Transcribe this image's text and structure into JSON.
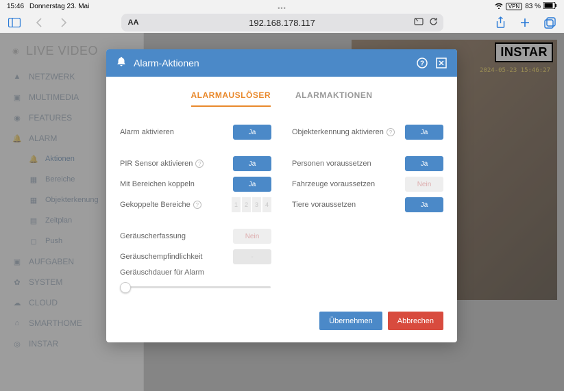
{
  "statusbar": {
    "time": "15:46",
    "date": "Donnerstag 23. Mai",
    "vpn": "VPN",
    "battery": "83 %"
  },
  "browser": {
    "url": "192.168.178.117",
    "aa": "AA"
  },
  "sidebar": {
    "title": "LIVE VIDEO",
    "items": [
      {
        "icon": "◆",
        "label": "NETZWERK"
      },
      {
        "icon": "▣",
        "label": "MULTIMEDIA"
      },
      {
        "icon": "◉",
        "label": "FEATURES"
      },
      {
        "icon": "🔔",
        "label": "ALARM"
      }
    ],
    "sub": [
      {
        "icon": "🔔",
        "label": "Aktionen"
      },
      {
        "icon": "▦",
        "label": "Bereiche"
      },
      {
        "icon": "▦",
        "label": "Objekterkenung"
      },
      {
        "icon": "▤",
        "label": "Zeitplan"
      },
      {
        "icon": "◻",
        "label": "Push"
      }
    ],
    "rest": [
      {
        "icon": "▣",
        "label": "AUFGABEN"
      },
      {
        "icon": "✿",
        "label": "SYSTEM"
      },
      {
        "icon": "☁",
        "label": "CLOUD"
      },
      {
        "icon": "⌂",
        "label": "SMARTHOME"
      },
      {
        "icon": "◎",
        "label": "INSTAR"
      }
    ]
  },
  "logo": {
    "prefix": "IN",
    "suffix": "STAR"
  },
  "camera_ts": "2024-05-23 15:46:27",
  "modal": {
    "title": "Alarm-Aktionen",
    "tabs": {
      "t1": "ALARMAUSLÖSER",
      "t2": "ALARMAKTIONEN"
    },
    "left": {
      "r1": "Alarm aktivieren",
      "r2": "PIR Sensor aktivieren",
      "r3": "Mit Bereichen koppeln",
      "r4": "Gekoppelte Bereiche",
      "r5": "Geräuscherfassung",
      "r6": "Geräuschempfindlichkeit",
      "r7": "Geräuschdauer für Alarm"
    },
    "right": {
      "r1": "Objekterkennung aktivieren",
      "r2": "Personen voraussetzen",
      "r3": "Fahrzeuge voraussetzen",
      "r4": "Tiere voraussetzen"
    },
    "toggles": {
      "yes": "Ja",
      "no": "Nein"
    },
    "nums": [
      "1",
      "2",
      "3",
      "4"
    ],
    "btn_ok": "Übernehmen",
    "btn_cancel": "Abbrechen"
  }
}
